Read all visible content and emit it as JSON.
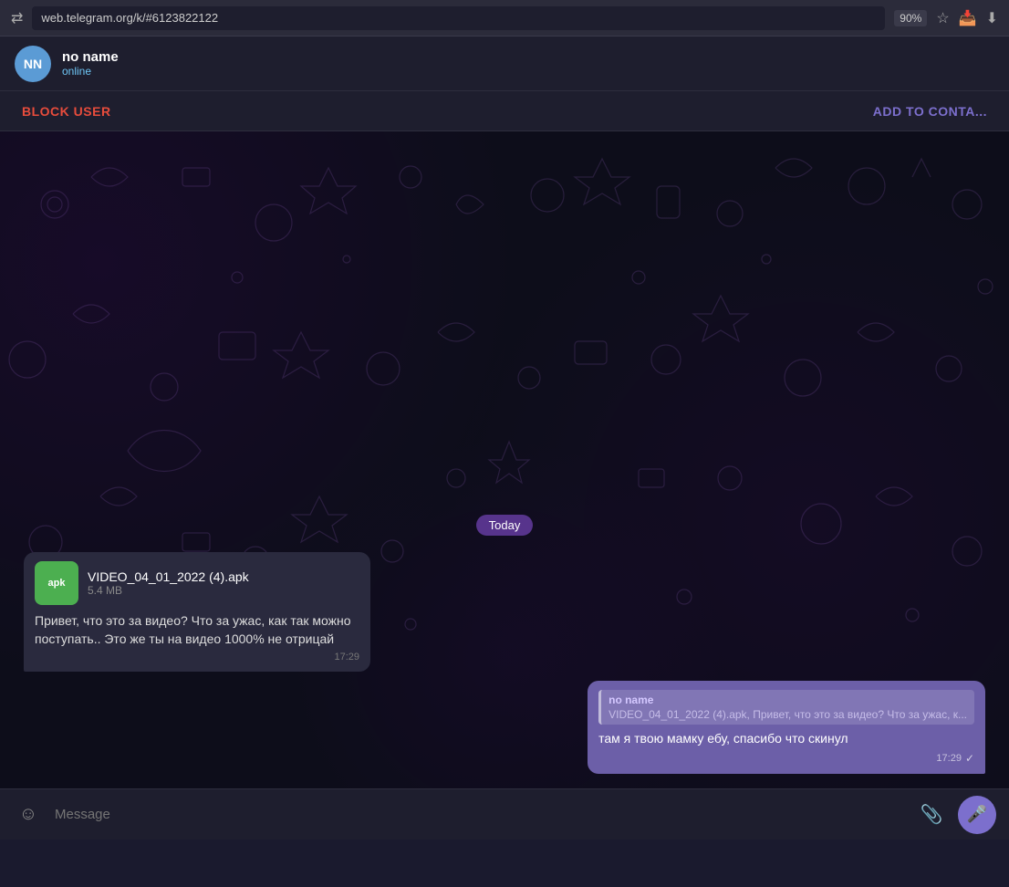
{
  "browser": {
    "url": "web.telegram.org/k/#6123822122",
    "zoom": "90%"
  },
  "header": {
    "avatar_initials": "NN",
    "user_name": "no name",
    "user_status": "online"
  },
  "action_bar": {
    "block_user_label": "BLOCK USER",
    "add_contact_label": "ADD TO CONTA..."
  },
  "chat": {
    "today_label": "Today",
    "messages": [
      {
        "type": "received",
        "attachment": {
          "name": "VIDEO_04_01_2022 (4).apk",
          "size": "5.4 MB",
          "icon_label": "apk"
        },
        "text": "Привет, что это за видео? Что за ужас, как так можно поступать.. Это же ты на видео 1000% не отрицай",
        "time": "17:29"
      },
      {
        "type": "sent",
        "reply": {
          "name": "no name",
          "text": "VIDEO_04_01_2022 (4).apk, Привет, что это за видео? Что за ужас, к..."
        },
        "text": "там я твою мамку ебу, спасибо что скинул",
        "time": "17:29",
        "read": true
      }
    ]
  },
  "input": {
    "placeholder": "Message"
  }
}
